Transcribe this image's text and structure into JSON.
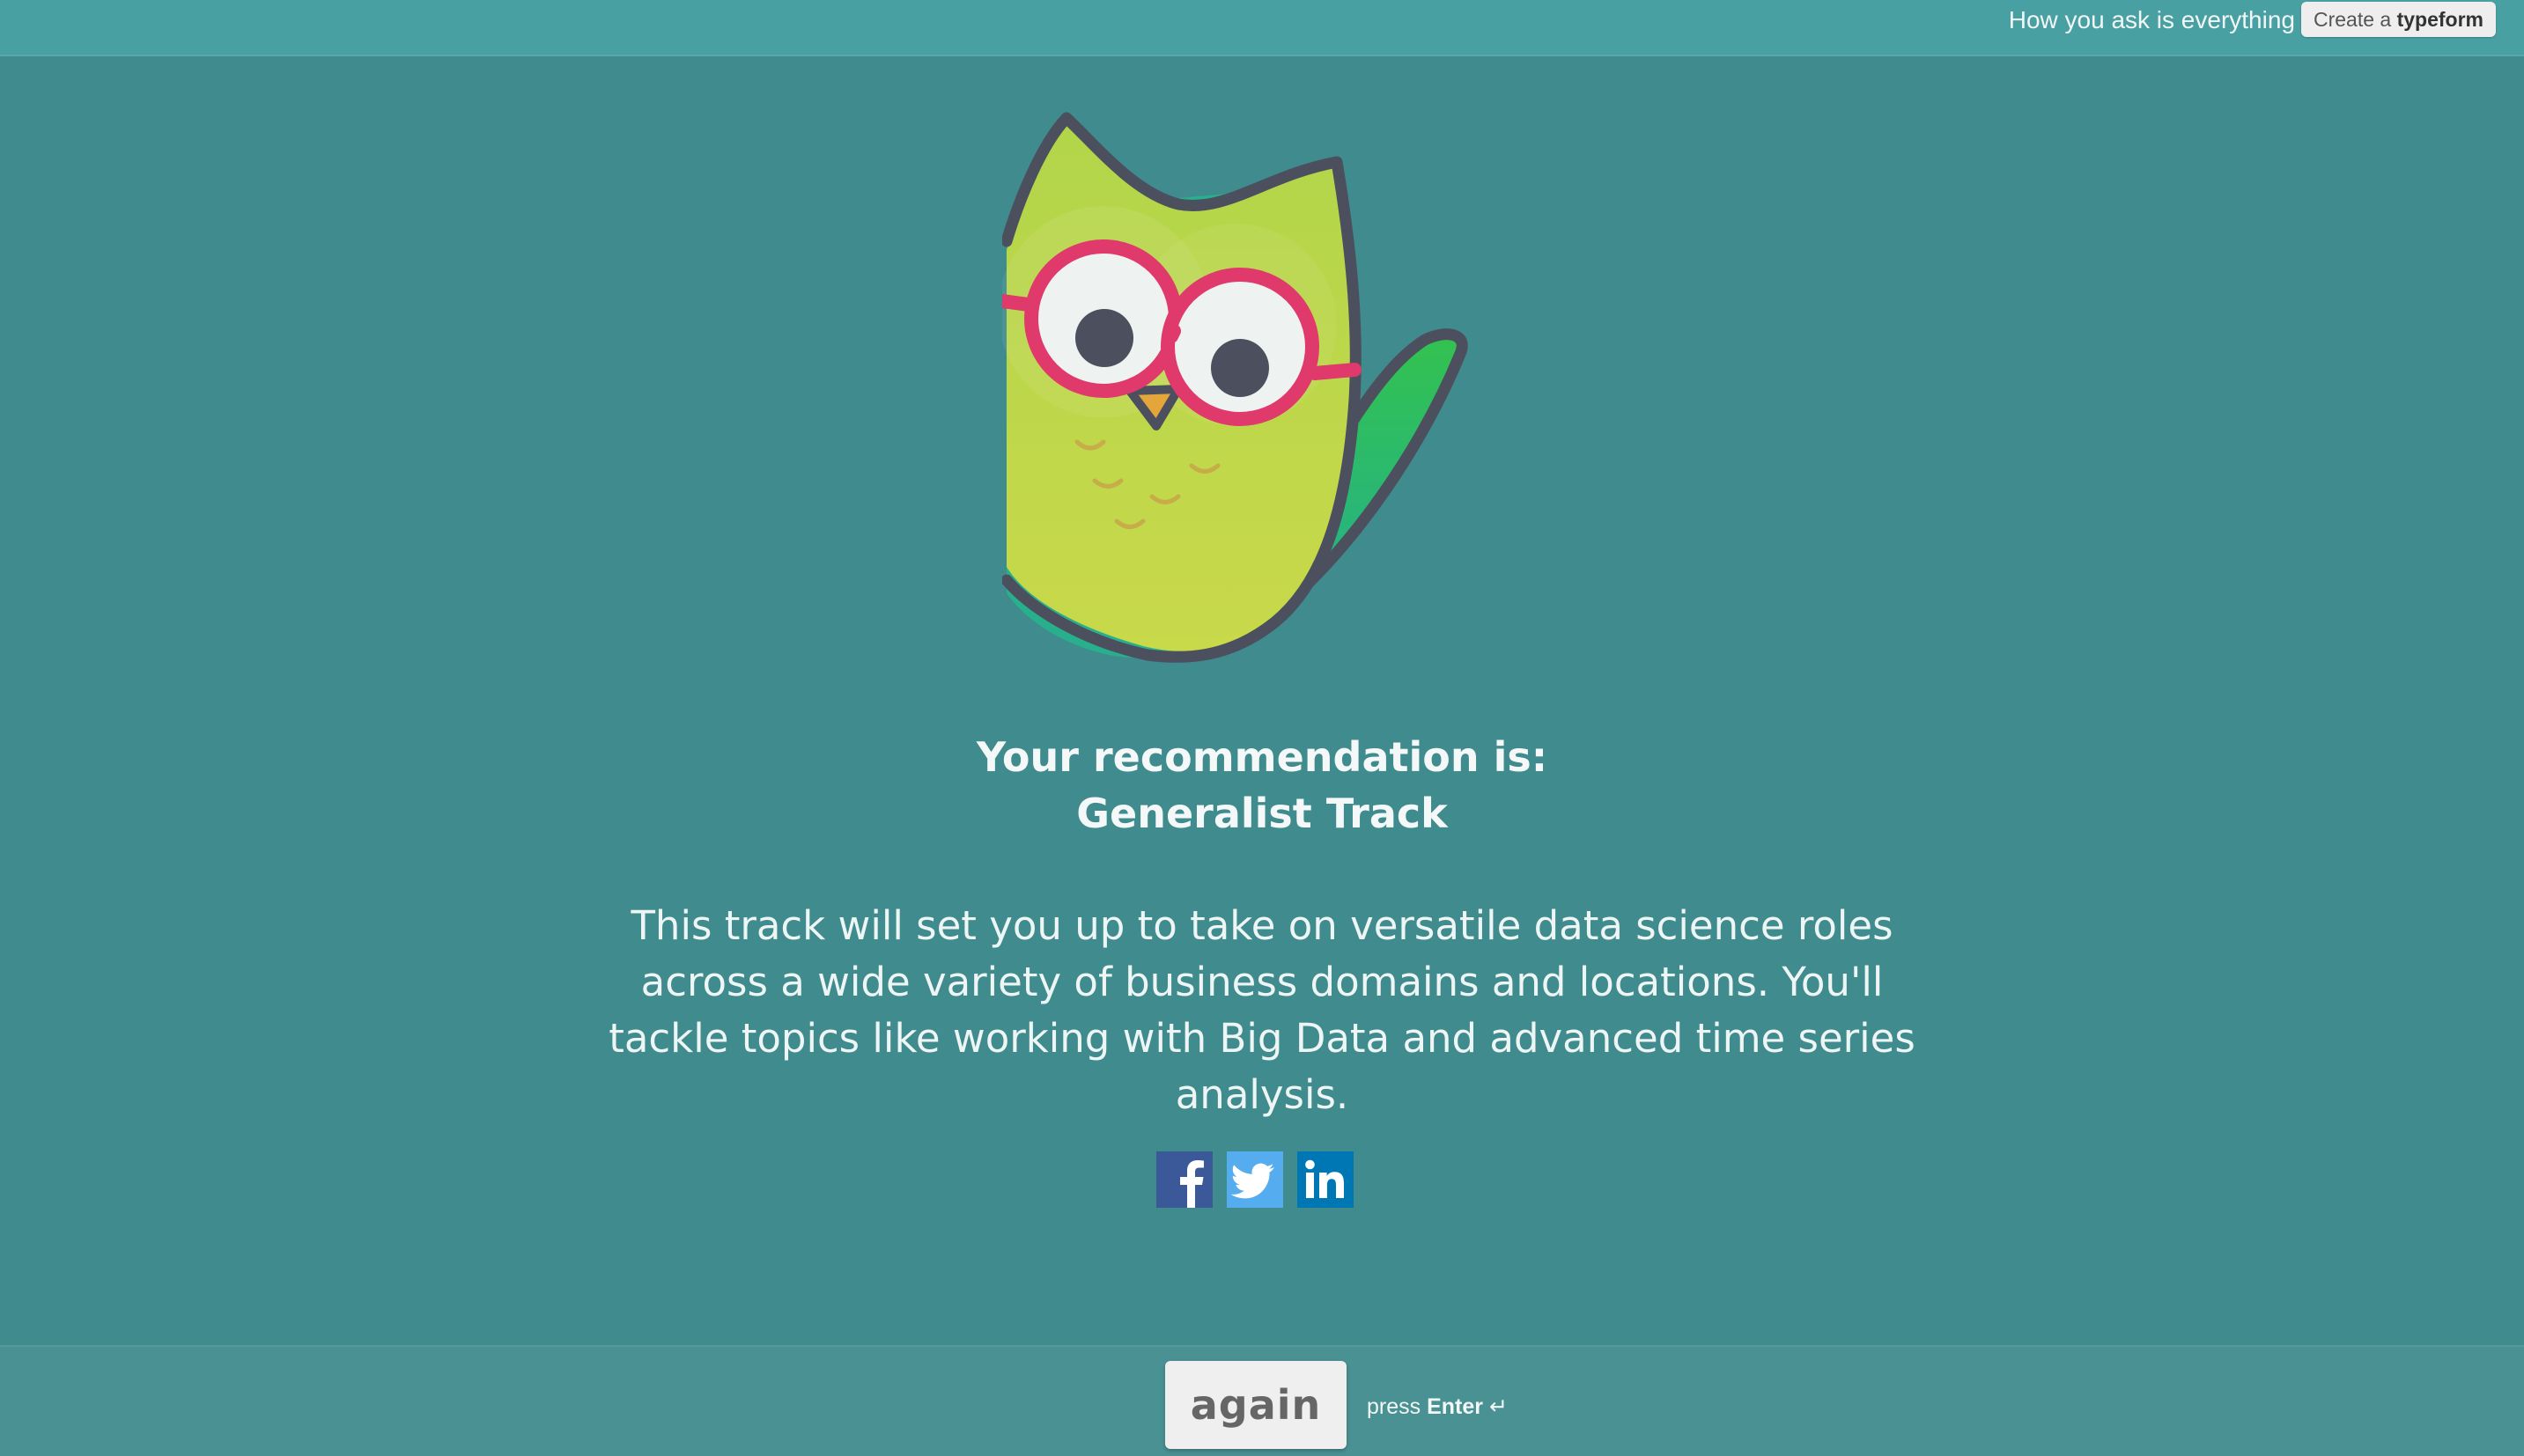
{
  "header": {
    "tagline": "How you ask is everything",
    "create_prefix": "Create a",
    "create_brand": "typeform"
  },
  "result": {
    "line1": "Your recommendation is:",
    "line2": "Generalist Track",
    "description": "This track will set you up to take on versatile data science roles across a wide variety of business domains and locations. You'll tackle topics like working with Big Data and advanced time series analysis."
  },
  "share": {
    "items": [
      {
        "name": "facebook",
        "icon": "facebook-icon",
        "color": "#3b5998"
      },
      {
        "name": "twitter",
        "icon": "twitter-icon",
        "color": "#55acee"
      },
      {
        "name": "linkedin",
        "icon": "linkedin-icon",
        "color": "#0077b5"
      }
    ]
  },
  "footer": {
    "again_label": "again",
    "hint_prefix": "press",
    "hint_key": "Enter",
    "hint_symbol": "↵"
  },
  "colors": {
    "background": "#3f8b8d",
    "topbar": "#49a0a3",
    "bottombar": "#4a9193",
    "owl_body": "#c2d84a",
    "owl_glasses": "#e0396b"
  }
}
